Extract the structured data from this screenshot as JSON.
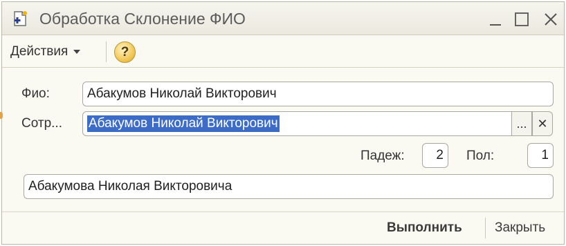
{
  "window": {
    "title": "Обработка  Склонение ФИО",
    "icon": "processing-doc-icon",
    "controls": {
      "minimize": "minimize-icon",
      "maximize": "maximize-icon",
      "close": "close-icon"
    }
  },
  "toolbar": {
    "actions_label": "Действия",
    "help_label": "?"
  },
  "form": {
    "fio_label": "Фио:",
    "fio_value": "Абакумов Николай Викторович",
    "employee_label": "Сотр...",
    "employee_value": "Абакумов Николай Викторович",
    "select_button": "...",
    "clear_button": "✕",
    "case_label": "Падеж:",
    "case_value": "2",
    "gender_label": "Пол:",
    "gender_value": "1",
    "result_value": "Абакумова Николая Викторовича"
  },
  "footer": {
    "run_label": "Выполнить",
    "close_label": "Закрыть"
  },
  "colors": {
    "window_bg": "#fbfaf2",
    "selection": "#3d6cc6",
    "help_gold": "#f2c75a"
  }
}
